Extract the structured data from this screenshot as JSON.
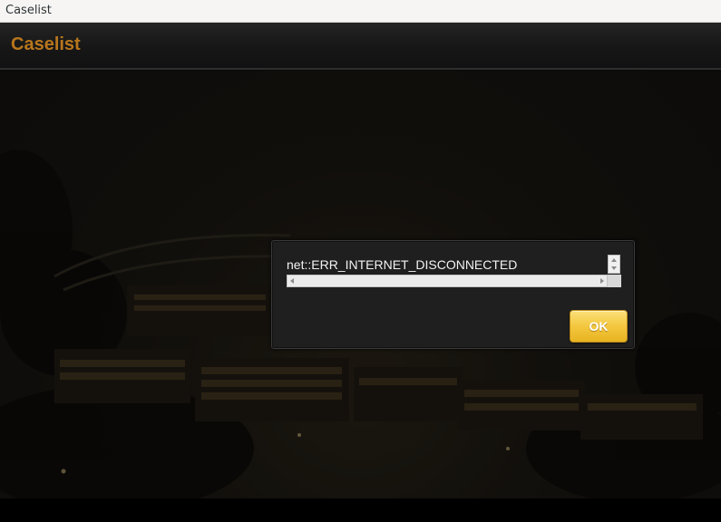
{
  "window": {
    "title": "Caselist"
  },
  "header": {
    "title": "Caselist",
    "title_color": "#b8761c"
  },
  "dialog": {
    "message": "net::ERR_INTERNET_DISCONNECTED",
    "ok_label": "OK",
    "button_color": "#f4c73f"
  },
  "background": {
    "scene": "night-building-photo"
  }
}
